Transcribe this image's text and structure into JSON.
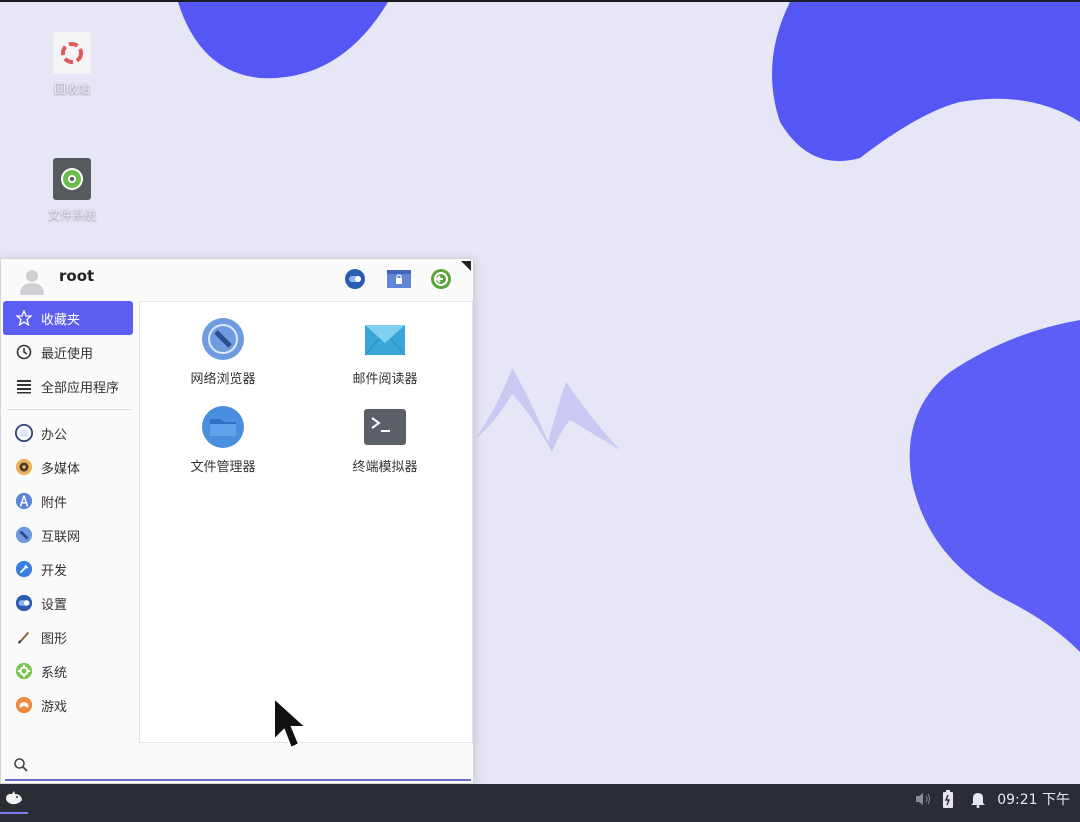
{
  "desktop": {
    "icons": [
      {
        "label": "回收站",
        "icon": "trash-icon"
      },
      {
        "label": "文件系统",
        "icon": "drive-icon"
      }
    ],
    "colors": {
      "background": "#e6e6f7",
      "blob": "#5557f5"
    }
  },
  "menu": {
    "username": "root",
    "header_buttons": [
      "settings-icon",
      "lock-screen-icon",
      "logout-icon"
    ],
    "categories": [
      {
        "label": "收藏夹",
        "icon": "star-icon",
        "active": true
      },
      {
        "label": "最近使用",
        "icon": "clock-icon"
      },
      {
        "label": "全部应用程序",
        "icon": "list-icon"
      },
      {
        "label": "办公",
        "icon": "office-icon"
      },
      {
        "label": "多媒体",
        "icon": "multimedia-icon"
      },
      {
        "label": "附件",
        "icon": "accessories-icon"
      },
      {
        "label": "互联网",
        "icon": "internet-icon"
      },
      {
        "label": "开发",
        "icon": "development-icon"
      },
      {
        "label": "设置",
        "icon": "settings-icon"
      },
      {
        "label": "图形",
        "icon": "graphics-icon"
      },
      {
        "label": "系统",
        "icon": "system-icon"
      },
      {
        "label": "游戏",
        "icon": "games-icon"
      }
    ],
    "apps": [
      {
        "label": "网络浏览器",
        "icon": "web-browser-icon"
      },
      {
        "label": "邮件阅读器",
        "icon": "mail-reader-icon"
      },
      {
        "label": "文件管理器",
        "icon": "file-manager-icon"
      },
      {
        "label": "终端模拟器",
        "icon": "terminal-icon"
      }
    ],
    "search": {
      "placeholder": ""
    },
    "accent": "#5b5ef0"
  },
  "panel": {
    "clock": "09:21 下午",
    "tray": [
      "volume-icon",
      "battery-icon",
      "notification-bell-icon"
    ]
  }
}
